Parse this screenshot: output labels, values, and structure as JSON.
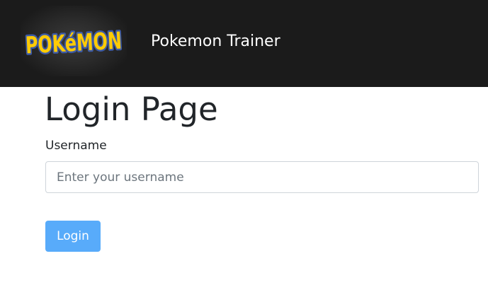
{
  "navbar": {
    "logo_text": "POKéMON",
    "brand_title": "Pokemon Trainer"
  },
  "main": {
    "title": "Login Page",
    "username_label": "Username",
    "username_placeholder": "Enter your username",
    "username_value": "",
    "login_label": "Login"
  },
  "colors": {
    "navbar_bg": "#1b1b1b",
    "button_bg": "#58abfa",
    "logo_yellow": "#ffcb05",
    "logo_blue": "#3c5aa6"
  }
}
